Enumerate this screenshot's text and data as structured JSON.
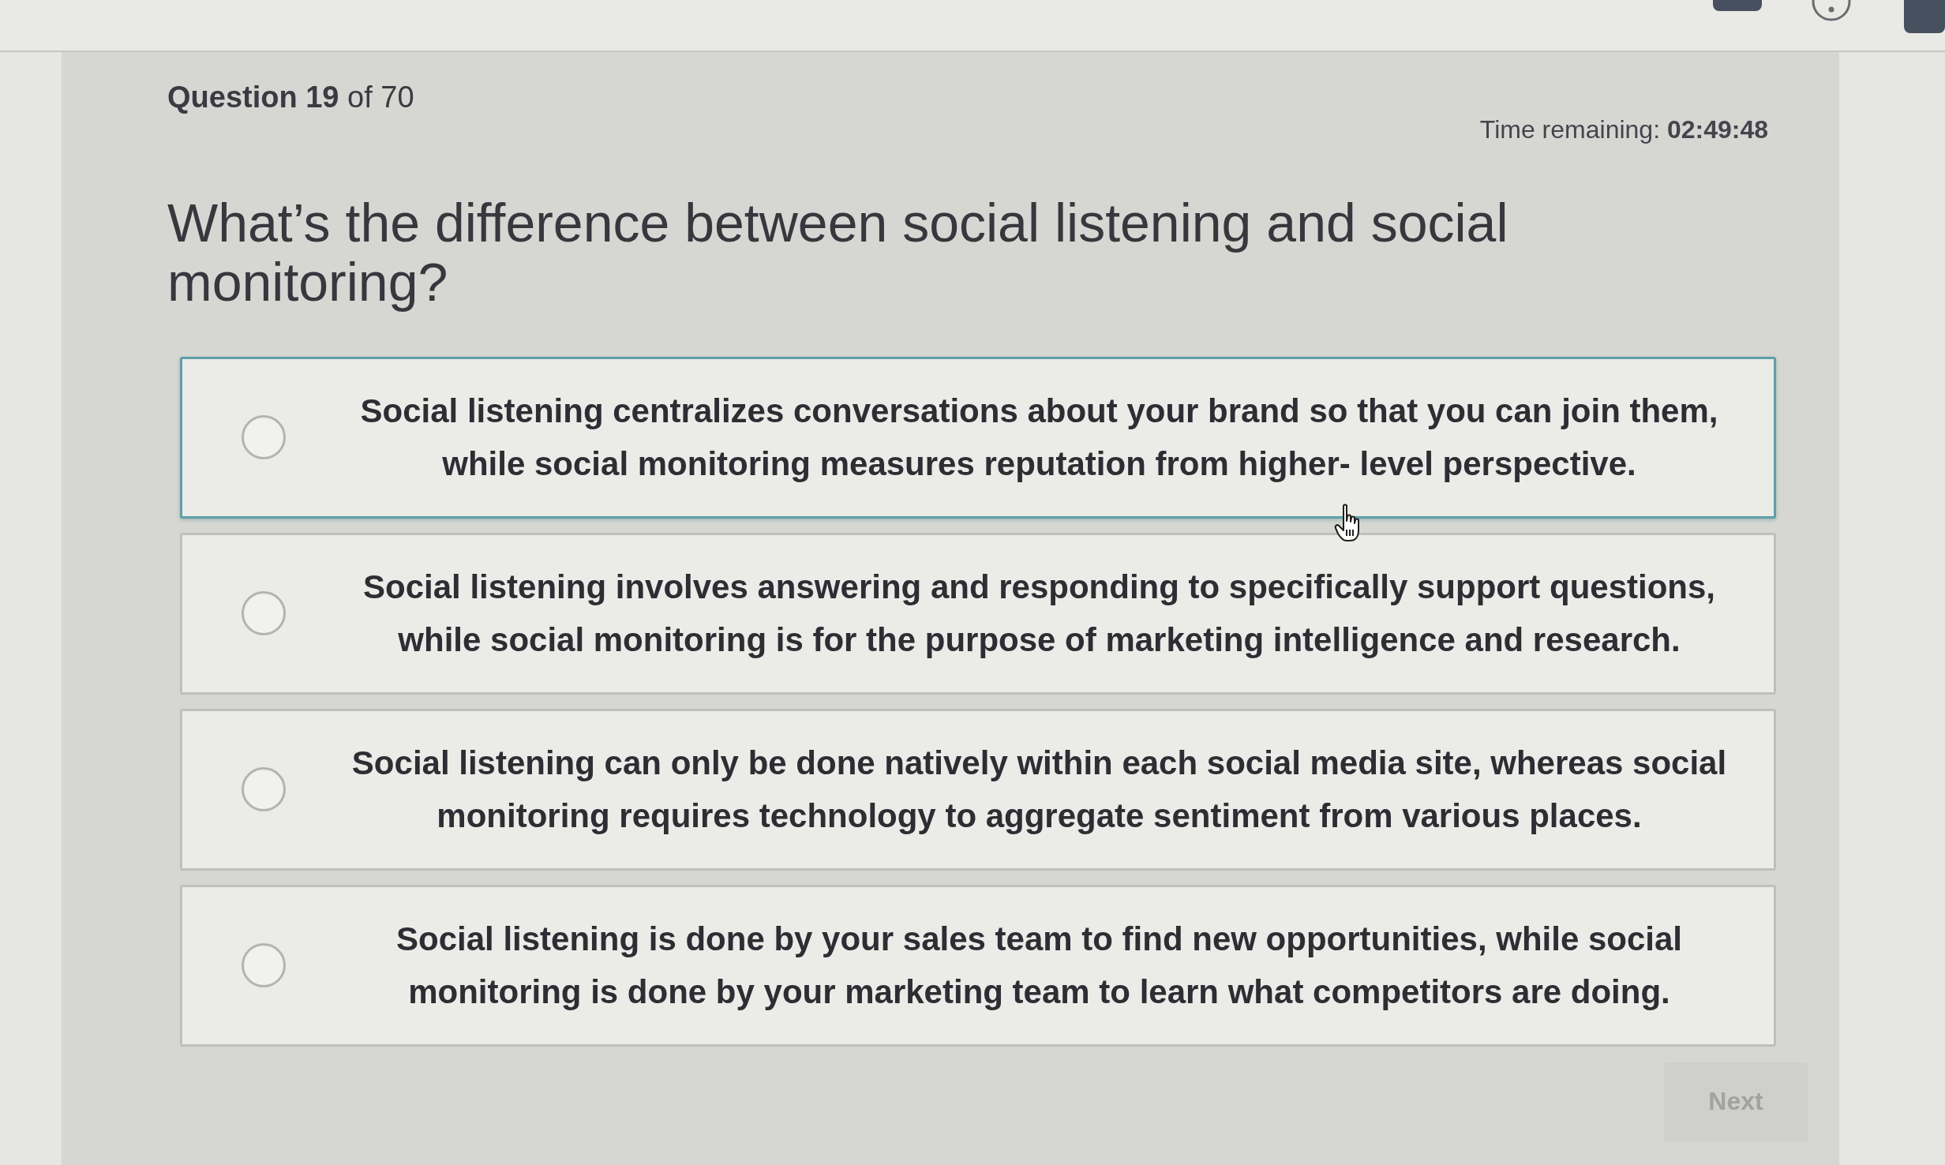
{
  "header": {
    "counter": "**Question 19** of 70",
    "timer": "Time remaining: **02:49:48**"
  },
  "question": "What’s the difference between social listening and social monitoring?",
  "options": [
    {
      "text": "Social listening centralizes conversations about your brand so that you can join them, while social monitoring measures reputation from higher- level perspective.",
      "selected": false,
      "hovered": true
    },
    {
      "text": "Social listening involves answering and responding to specifically support questions, while social monitoring is for the purpose of marketing intelligence and research.",
      "selected": false,
      "hovered": false
    },
    {
      "text": "Social listening can only be done natively within each social media site, whereas social monitoring requires technology to aggregate sentiment from various places.",
      "selected": false,
      "hovered": false
    },
    {
      "text": "Social listening is done by your sales team to find new opportunities, while social monitoring is done by your marketing team to learn what competitors are doing.",
      "selected": false,
      "hovered": false
    }
  ],
  "next_button": {
    "label": "Next",
    "disabled": true
  }
}
